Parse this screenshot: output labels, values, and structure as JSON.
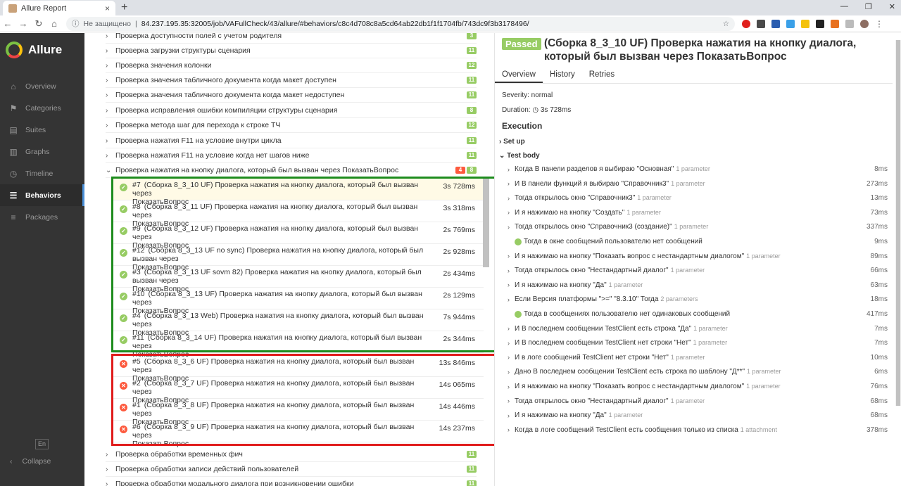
{
  "browser": {
    "tab_title": "Allure Report",
    "security": "Не защищено",
    "url": "84.237.195.35:32005/job/VAFullCheck/43/allure/#behaviors/c8c4d708c8a5cd64ab22db1f1f1704fb/743dc9f3b3178496/"
  },
  "sidebar": {
    "brand": "Allure",
    "items": [
      {
        "label": "Overview",
        "icon": "home-icon"
      },
      {
        "label": "Categories",
        "icon": "flag-icon"
      },
      {
        "label": "Suites",
        "icon": "briefcase-icon"
      },
      {
        "label": "Graphs",
        "icon": "bar-chart-icon"
      },
      {
        "label": "Timeline",
        "icon": "clock-icon"
      },
      {
        "label": "Behaviors",
        "icon": "list-icon"
      },
      {
        "label": "Packages",
        "icon": "align-left-icon"
      }
    ],
    "lang": "En",
    "collapse": "Collapse"
  },
  "tree": {
    "groups_top": [
      {
        "name": "Проверка доступности полей с учетом родителя",
        "passed": "3"
      },
      {
        "name": "Проверка загрузки структуры сценария",
        "passed": "11"
      },
      {
        "name": "Проверка значения колонки",
        "passed": "12"
      },
      {
        "name": "Проверка значения табличного документа когда макет доступен",
        "passed": "11"
      },
      {
        "name": "Проверка значения табличного документа когда макет недоступен",
        "passed": "11"
      },
      {
        "name": "Проверка исправления ошибки компиляции структуры сценария",
        "passed": "8"
      },
      {
        "name": "Проверка метода шаг для перехода к строке ТЧ",
        "passed": "12"
      },
      {
        "name": "Проверка нажатия F11 на условие внутри цикла",
        "passed": "11"
      },
      {
        "name": "Проверка нажатия F11 на условие когда нет шагов ниже",
        "passed": "11"
      }
    ],
    "open_group": {
      "name": "Проверка нажатия на кнопку диалога, который был вызван через ПоказатьВопрос",
      "failed": "4",
      "passed": "8"
    },
    "items": [
      {
        "num": "#7",
        "line1": "(Сборка 8_3_10 UF) Проверка нажатия на кнопку диалога, который был вызван через",
        "line2": "ПоказатьВопрос",
        "dur": "3s 728ms"
      },
      {
        "num": "#8",
        "line1": "(Сборка 8_3_11 UF) Проверка нажатия на кнопку диалога, который был вызван через",
        "line2": "ПоказатьВопрос",
        "dur": "3s 318ms"
      },
      {
        "num": "#9",
        "line1": "(Сборка 8_3_12 UF) Проверка нажатия на кнопку диалога, который был вызван через",
        "line2": "ПоказатьВопрос",
        "dur": "2s 769ms"
      },
      {
        "num": "#12",
        "line1": "(Сборка 8_3_13 UF no sync) Проверка нажатия на кнопку диалога, который был вызван через",
        "line2": "ПоказатьВопрос",
        "dur": "2s 928ms"
      },
      {
        "num": "#3",
        "line1": "(Сборка 8_3_13 UF sovm 82) Проверка нажатия на кнопку диалога, который был вызван через",
        "line2": "ПоказатьВопрос",
        "dur": "2s 434ms"
      },
      {
        "num": "#10",
        "line1": "(Сборка 8_3_13 UF) Проверка нажатия на кнопку диалога, который был вызван через",
        "line2": "ПоказатьВопрос",
        "dur": "2s 129ms"
      },
      {
        "num": "#4",
        "line1": "(Сборка 8_3_13 Web) Проверка нажатия на кнопку диалога, который был вызван через",
        "line2": "ПоказатьВопрос",
        "dur": "7s 944ms"
      },
      {
        "num": "#11",
        "line1": "(Сборка 8_3_14 UF) Проверка нажатия на кнопку диалога, который был вызван через",
        "line2": "ПоказатьВопрос",
        "dur": "2s 344ms"
      },
      {
        "num": "#5",
        "line1": "(Сборка 8_3_6 UF) Проверка нажатия на кнопку диалога, который был вызван через",
        "line2": "ПоказатьВопрос",
        "dur": "13s 846ms"
      },
      {
        "num": "#2",
        "line1": "(Сборка 8_3_7 UF) Проверка нажатия на кнопку диалога, который был вызван через",
        "line2": "ПоказатьВопрос",
        "dur": "14s 065ms"
      },
      {
        "num": "#1",
        "line1": "(Сборка 8_3_8 UF) Проверка нажатия на кнопку диалога, который был вызван через",
        "line2": "ПоказатьВопрос",
        "dur": "14s 446ms"
      },
      {
        "num": "#6",
        "line1": "(Сборка 8_3_9 UF) Проверка нажатия на кнопку диалога, который был вызван через",
        "line2": "ПоказатьВопрос",
        "dur": "14s 237ms"
      }
    ],
    "groups_bottom": [
      {
        "name": "Проверка обработки временных фич",
        "passed": "11"
      },
      {
        "name": "Проверка обработки записи действий пользователей",
        "passed": "11"
      },
      {
        "name": "Проверка обработки модального диалога при возникновении ошибки",
        "passed": "11"
      }
    ]
  },
  "detail": {
    "status": "Passed",
    "title": "(Сборка 8_3_10 UF) Проверка нажатия на кнопку диалога, который был вызван через ПоказатьВопрос",
    "tabs": [
      "Overview",
      "History",
      "Retries"
    ],
    "severity": "Severity: normal",
    "duration_label": "Duration:",
    "duration": "3s 728ms",
    "execution": "Execution",
    "setup": "Set up",
    "test_body": "Test body",
    "steps": [
      {
        "text": "Когда В панели разделов я выбираю \"Основная\"",
        "param": "1 parameter",
        "dur": "8ms",
        "exp": true
      },
      {
        "text": "И В панели функций я выбираю \"Справочник3\"",
        "param": "1 parameter",
        "dur": "273ms",
        "exp": true
      },
      {
        "text": "Тогда открылось окно \"Справочник3\"",
        "param": "1 parameter",
        "dur": "13ms",
        "exp": true
      },
      {
        "text": "И я нажимаю на кнопку \"Создать\"",
        "param": "1 parameter",
        "dur": "73ms",
        "exp": true
      },
      {
        "text": "Тогда открылось окно \"Справочник3 (создание)\"",
        "param": "1 parameter",
        "dur": "337ms",
        "exp": true
      },
      {
        "text": "Тогда в окне сообщений пользователю нет сообщений",
        "param": "",
        "dur": "9ms",
        "exp": false
      },
      {
        "text": "И я нажимаю на кнопку \"Показать вопрос с нестандартным диалогом\"",
        "param": "1 parameter",
        "dur": "89ms",
        "exp": true
      },
      {
        "text": "Тогда открылось окно \"Нестандартный диалог\"",
        "param": "1 parameter",
        "dur": "66ms",
        "exp": true
      },
      {
        "text": "И я нажимаю на кнопку \"Да\"",
        "param": "1 parameter",
        "dur": "63ms",
        "exp": true
      },
      {
        "text": "Если Версия платформы \">=\" \"8.3.10\" Тогда",
        "param": "2 parameters",
        "dur": "18ms",
        "exp": true
      },
      {
        "text": "Тогда в сообщениях пользователю нет одинаковых сообщений",
        "param": "",
        "dur": "417ms",
        "exp": false
      },
      {
        "text": "И В последнем сообщении TestClient есть строка \"Да\"",
        "param": "1 parameter",
        "dur": "7ms",
        "exp": true
      },
      {
        "text": "И В последнем сообщении TestClient нет строки \"Нет\"",
        "param": "1 parameter",
        "dur": "7ms",
        "exp": true
      },
      {
        "text": "И в логе сообщений TestClient нет строки \"Нет\"",
        "param": "1 parameter",
        "dur": "10ms",
        "exp": true
      },
      {
        "text": "Дано В последнем сообщении TestClient есть строка по шаблону \"Д**\"",
        "param": "1 parameter",
        "dur": "6ms",
        "exp": true
      },
      {
        "text": "И я нажимаю на кнопку \"Показать вопрос с нестандартным диалогом\"",
        "param": "1 parameter",
        "dur": "76ms",
        "exp": true
      },
      {
        "text": "Тогда открылось окно \"Нестандартный диалог\"",
        "param": "1 parameter",
        "dur": "68ms",
        "exp": true
      },
      {
        "text": "И я нажимаю на кнопку \"Да\"",
        "param": "1 parameter",
        "dur": "68ms",
        "exp": true
      },
      {
        "text": "Когда в логе сообщений TestClient есть сообщения только из списка",
        "param": "1 attachment",
        "dur": "378ms",
        "exp": true
      }
    ]
  },
  "colors": {
    "passed": "#97cc64",
    "failed": "#fd5a3e",
    "green_box": "#1e8c1e",
    "red_box": "#e01b1b"
  }
}
